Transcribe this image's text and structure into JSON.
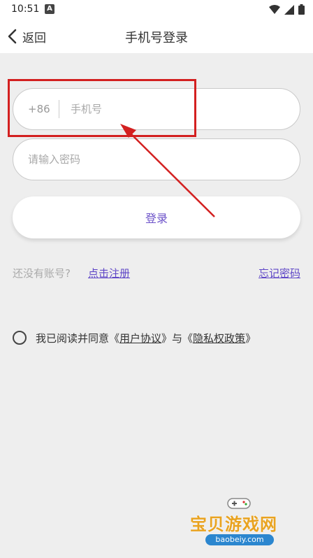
{
  "status_bar": {
    "time": "10:51",
    "app_icon": "A"
  },
  "header": {
    "back_label": "返回",
    "title": "手机号登录"
  },
  "form": {
    "country_code": "+86",
    "phone_placeholder": "手机号",
    "password_placeholder": "请输入密码",
    "login_label": "登录"
  },
  "links": {
    "no_account": "还没有账号?",
    "register": "点击注册",
    "forgot_password": "忘记密码"
  },
  "agreement": {
    "prefix": "我已阅读并同意《",
    "user_agreement": "用户协议",
    "middle": "》与《",
    "privacy_policy": "隐私权政策",
    "suffix": "》"
  },
  "watermark": {
    "title": "宝贝游戏网",
    "url": "baobeiy.com"
  },
  "colors": {
    "accent": "#5f47c7",
    "annotation": "#d32020",
    "background": "#eeeeee"
  },
  "icons": [
    "back-chevron-icon",
    "wifi-icon",
    "signal-icon",
    "battery-icon",
    "radio-circle-icon",
    "gamepad-icon"
  ]
}
